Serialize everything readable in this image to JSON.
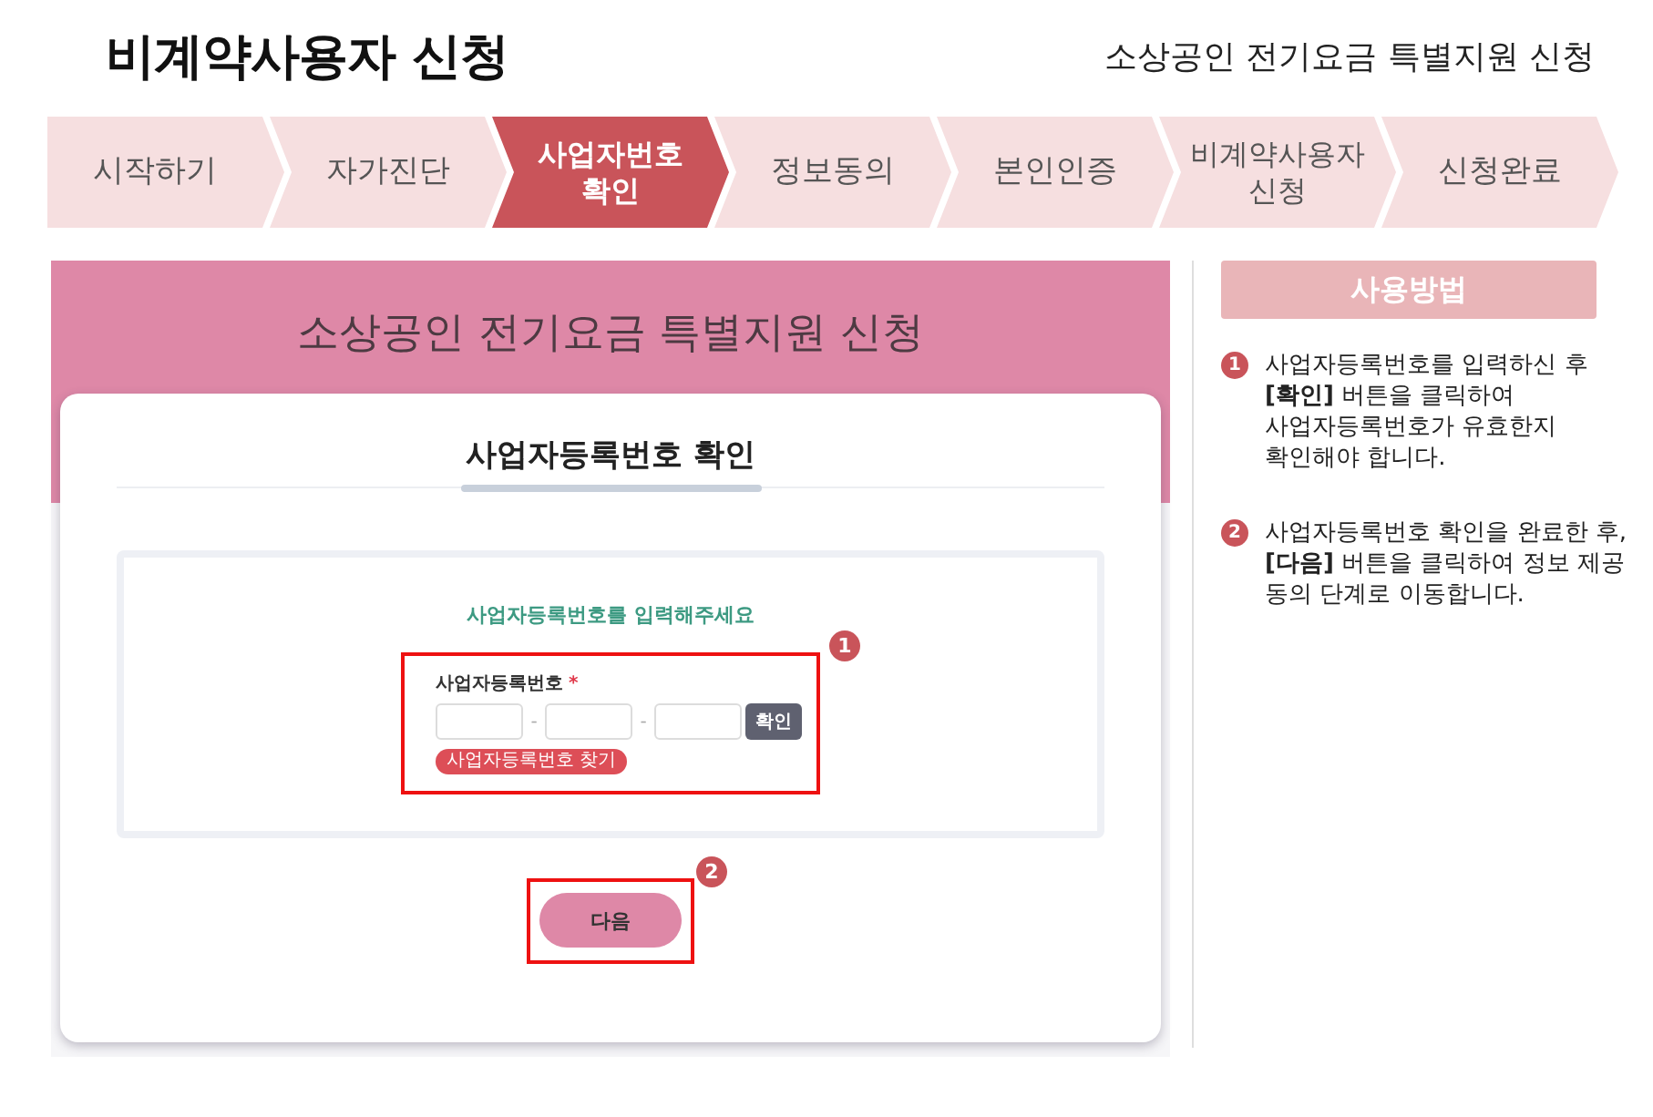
{
  "header": {
    "title": "비계약사용자 신청",
    "subtitle": "소상공인 전기요금 특별지원 신청"
  },
  "steps": [
    {
      "lines": [
        "시작하기"
      ],
      "selected": false
    },
    {
      "lines": [
        "자가진단"
      ],
      "selected": false
    },
    {
      "lines": [
        "사업자번호",
        "확인"
      ],
      "selected": true
    },
    {
      "lines": [
        "정보동의"
      ],
      "selected": false
    },
    {
      "lines": [
        "본인인증"
      ],
      "selected": false
    },
    {
      "lines": [
        "비계약사용자",
        "신청"
      ],
      "selected": false
    },
    {
      "lines": [
        "신청완료"
      ],
      "selected": false
    }
  ],
  "screen": {
    "banner_title": "소상공인 전기요금 특별지원 신청",
    "card_title": "사업자등록번호 확인",
    "prompt": "사업자등록번호를 입력해주세요",
    "form": {
      "callout": "1",
      "label": "사업자등록번호",
      "required_mark": "*",
      "separators": [
        "-",
        "-"
      ],
      "confirm_button": "확인",
      "find_link": "사업자등록번호 찾기"
    },
    "next": {
      "callout": "2",
      "button": "다음"
    }
  },
  "help": {
    "title": "사용방법",
    "items": [
      {
        "number": "1",
        "text": "사업자등록번호를 입력하신 후 **[확인]** 버튼을 클릭하여 사업자등록번호가 유효한지 확인해야 합니다."
      },
      {
        "number": "2",
        "text": "사업자등록번호 확인을 완료한 후, **[다음]** 버튼을 클릭하여 정보 제공 동의 단계로 이동합니다."
      }
    ]
  }
}
